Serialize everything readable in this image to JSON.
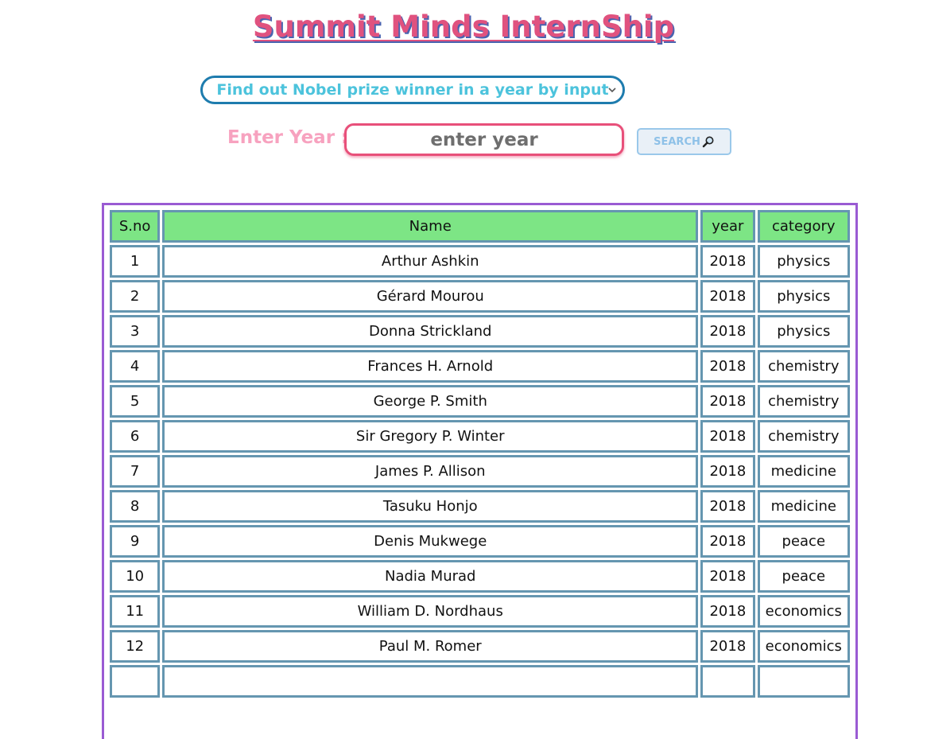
{
  "header": {
    "title": "Summit Minds InternShip"
  },
  "controls": {
    "mode_select_value": "Find out Nobel prize winner in a year by input",
    "year_label": "Enter Year :",
    "year_input_value": "",
    "year_input_placeholder": "enter year",
    "search_button_label": "SEARCH"
  },
  "table": {
    "headers": [
      "S.no",
      "Name",
      "year",
      "category"
    ],
    "rows": [
      [
        "1",
        "Arthur Ashkin",
        "2018",
        "physics"
      ],
      [
        "2",
        "Gérard Mourou",
        "2018",
        "physics"
      ],
      [
        "3",
        "Donna Strickland",
        "2018",
        "physics"
      ],
      [
        "4",
        "Frances H. Arnold",
        "2018",
        "chemistry"
      ],
      [
        "5",
        "George P. Smith",
        "2018",
        "chemistry"
      ],
      [
        "6",
        "Sir Gregory P. Winter",
        "2018",
        "chemistry"
      ],
      [
        "7",
        "James P. Allison",
        "2018",
        "medicine"
      ],
      [
        "8",
        "Tasuku Honjo",
        "2018",
        "medicine"
      ],
      [
        "9",
        "Denis Mukwege",
        "2018",
        "peace"
      ],
      [
        "10",
        "Nadia Murad",
        "2018",
        "peace"
      ],
      [
        "11",
        "William D. Nordhaus",
        "2018",
        "economics"
      ],
      [
        "12",
        "Paul M. Romer",
        "2018",
        "economics"
      ],
      [
        "",
        "",
        "",
        ""
      ]
    ]
  },
  "icons": {
    "select_arrow": "chevron-down-icon",
    "search": "search-icon"
  },
  "colors": {
    "title": "#e0527f",
    "title_shadow": "#4a63b0",
    "select_border": "#1e7cae",
    "select_text": "#4cc3dc",
    "year_label": "#f7a2bf",
    "input_border": "#e8507a",
    "table_border": "#9a5bd3",
    "cell_border": "#6596b0",
    "header_bg": "#7de585"
  }
}
